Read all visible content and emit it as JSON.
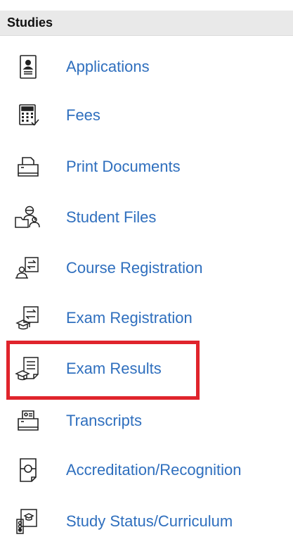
{
  "section": {
    "title": "Studies"
  },
  "menu": {
    "items": [
      {
        "label": "Applications",
        "icon": "application-form-icon"
      },
      {
        "label": "Fees",
        "icon": "calculator-icon"
      },
      {
        "label": "Print Documents",
        "icon": "printer-icon"
      },
      {
        "label": "Student Files",
        "icon": "student-files-icon"
      },
      {
        "label": "Course Registration",
        "icon": "course-registration-icon"
      },
      {
        "label": "Exam Registration",
        "icon": "exam-registration-icon"
      },
      {
        "label": "Exam Results",
        "icon": "exam-results-icon",
        "highlighted": true
      },
      {
        "label": "Transcripts",
        "icon": "transcript-printer-icon"
      },
      {
        "label": "Accreditation/Recognition",
        "icon": "accreditation-document-icon"
      },
      {
        "label": "Study Status/Curriculum",
        "icon": "study-status-icon"
      }
    ]
  },
  "colors": {
    "link": "#2f6fbe",
    "header_bg": "#e9e9e9",
    "highlight": "#e0242c"
  }
}
